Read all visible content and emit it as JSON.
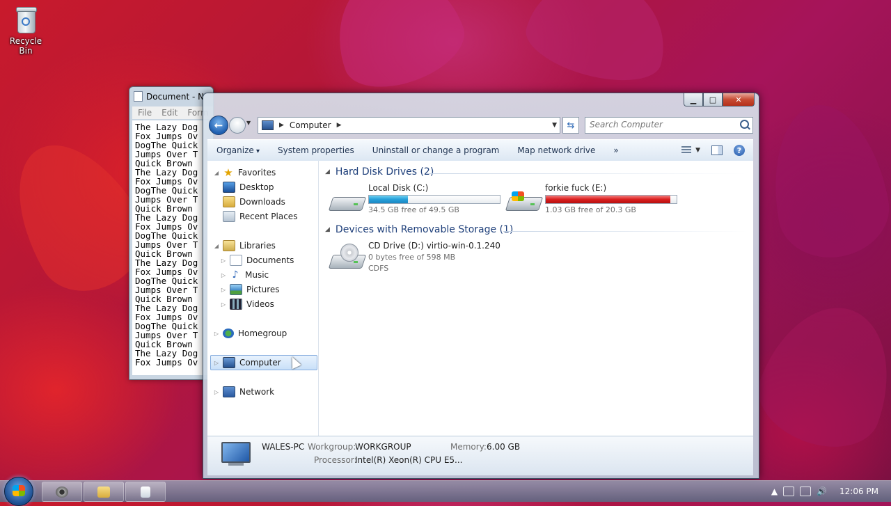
{
  "desktop": {
    "recycle_bin_label": "Recycle Bin"
  },
  "notepad": {
    "title": "Document - N",
    "menu": [
      "File",
      "Edit",
      "Form"
    ],
    "text_lines": [
      "The Lazy Dog",
      "Fox Jumps Ov",
      "DogThe Quick",
      "Jumps Over T",
      "Quick Brown",
      "The Lazy Dog",
      "Fox Jumps Ov",
      "DogThe Quick",
      "Jumps Over T",
      "Quick Brown",
      "The Lazy Dog",
      "Fox Jumps Ov",
      "DogThe Quick",
      "Jumps Over T",
      "Quick Brown",
      "The Lazy Dog",
      "Fox Jumps Ov",
      "DogThe Quick",
      "Jumps Over T",
      "Quick Brown",
      "The Lazy Dog",
      "Fox Jumps Ov",
      "DogThe Quick",
      "Jumps Over T",
      "Quick Brown",
      "The Lazy Dog",
      "Fox Jumps Ov"
    ]
  },
  "explorer": {
    "address": {
      "crumb": "Computer"
    },
    "search": {
      "placeholder": "Search Computer"
    },
    "toolbar": {
      "organize": "Organize",
      "system_properties": "System properties",
      "uninstall": "Uninstall or change a program",
      "map_drive": "Map network drive",
      "more": "»"
    },
    "nav": {
      "favorites": "Favorites",
      "desktop": "Desktop",
      "downloads": "Downloads",
      "recent_places": "Recent Places",
      "libraries": "Libraries",
      "documents": "Documents",
      "music": "Music",
      "pictures": "Pictures",
      "videos": "Videos",
      "homegroup": "Homegroup",
      "computer": "Computer",
      "network": "Network"
    },
    "groups": {
      "hard_disks": "Hard Disk Drives (2)",
      "removable": "Devices with Removable Storage (1)"
    },
    "drives": {
      "c": {
        "name": "Local Disk (C:)",
        "free": "34.5 GB free of 49.5 GB",
        "used_fraction": 0.3
      },
      "e": {
        "name": "forkie fuck (E:)",
        "free": "1.03 GB free of 20.3 GB",
        "used_fraction": 0.95
      },
      "d": {
        "name": "CD Drive (D:) virtio-win-0.1.240",
        "free": "0 bytes free of 598 MB",
        "fs": "CDFS"
      }
    },
    "details": {
      "pc_name": "WALES-PC",
      "workgroup_label": "Workgroup:",
      "workgroup": "WORKGROUP",
      "memory_label": "Memory:",
      "memory": "6.00 GB",
      "processor_label": "Processor:",
      "processor": "Intel(R) Xeon(R) CPU E5..."
    }
  },
  "taskbar": {
    "clock": "12:06 PM"
  },
  "colors": {
    "drive_ok": "#26a0da",
    "drive_full": "#da1f1f",
    "group_header": "#1e3f7a"
  }
}
